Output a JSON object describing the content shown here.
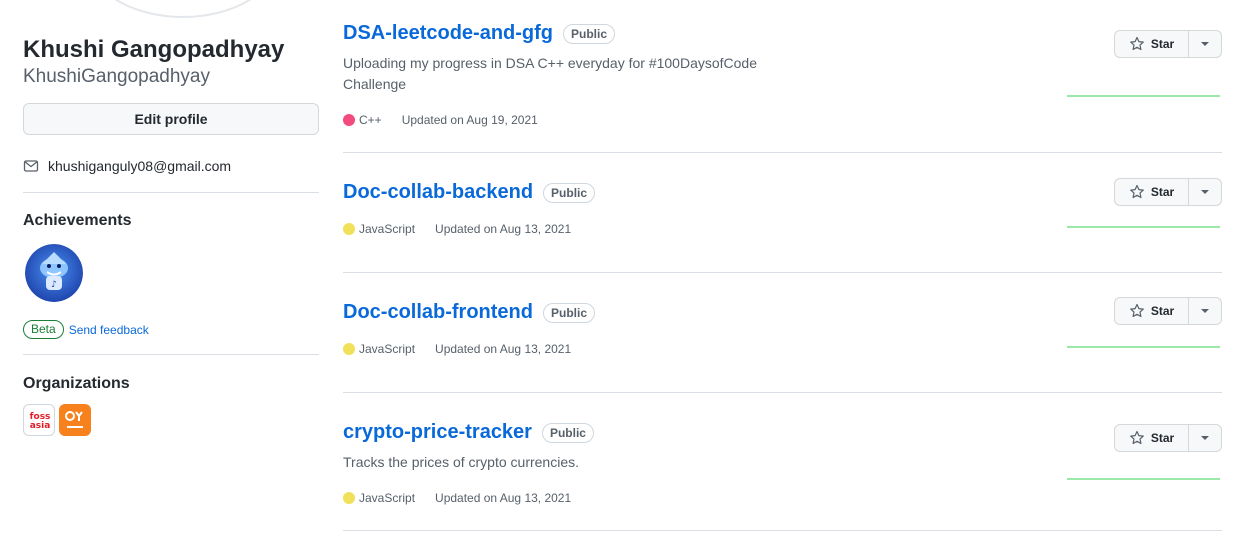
{
  "profile": {
    "name": "Khushi Gangopadhyay",
    "login": "KhushiGangopadhyay",
    "edit_label": "Edit profile",
    "email": "khushiganguly08@gmail.com"
  },
  "achievements": {
    "title": "Achievements",
    "beta_label": "Beta",
    "feedback_label": "Send feedback"
  },
  "organizations": {
    "title": "Organizations",
    "items": [
      "fossasia",
      "opntec"
    ]
  },
  "repos": [
    {
      "name": "DSA-leetcode-and-gfg",
      "visibility": "Public",
      "description": "Uploading my progress in DSA C++ everyday for #100DaysofCode Challenge",
      "language": "C++",
      "language_color": "#f34b7d",
      "updated": "Updated on Aug 19, 2021",
      "star_label": "Star"
    },
    {
      "name": "Doc-collab-backend",
      "visibility": "Public",
      "description": "",
      "language": "JavaScript",
      "language_color": "#f1e05a",
      "updated": "Updated on Aug 13, 2021",
      "star_label": "Star"
    },
    {
      "name": "Doc-collab-frontend",
      "visibility": "Public",
      "description": "",
      "language": "JavaScript",
      "language_color": "#f1e05a",
      "updated": "Updated on Aug 13, 2021",
      "star_label": "Star"
    },
    {
      "name": "crypto-price-tracker",
      "visibility": "Public",
      "description": "Tracks the prices of crypto currencies.",
      "language": "JavaScript",
      "language_color": "#f1e05a",
      "updated": "Updated on Aug 13, 2021",
      "star_label": "Star"
    }
  ],
  "colors": {
    "link": "#0969da",
    "muted": "#57606a",
    "border": "#d8dee4",
    "beta_green": "#1a7f37"
  }
}
